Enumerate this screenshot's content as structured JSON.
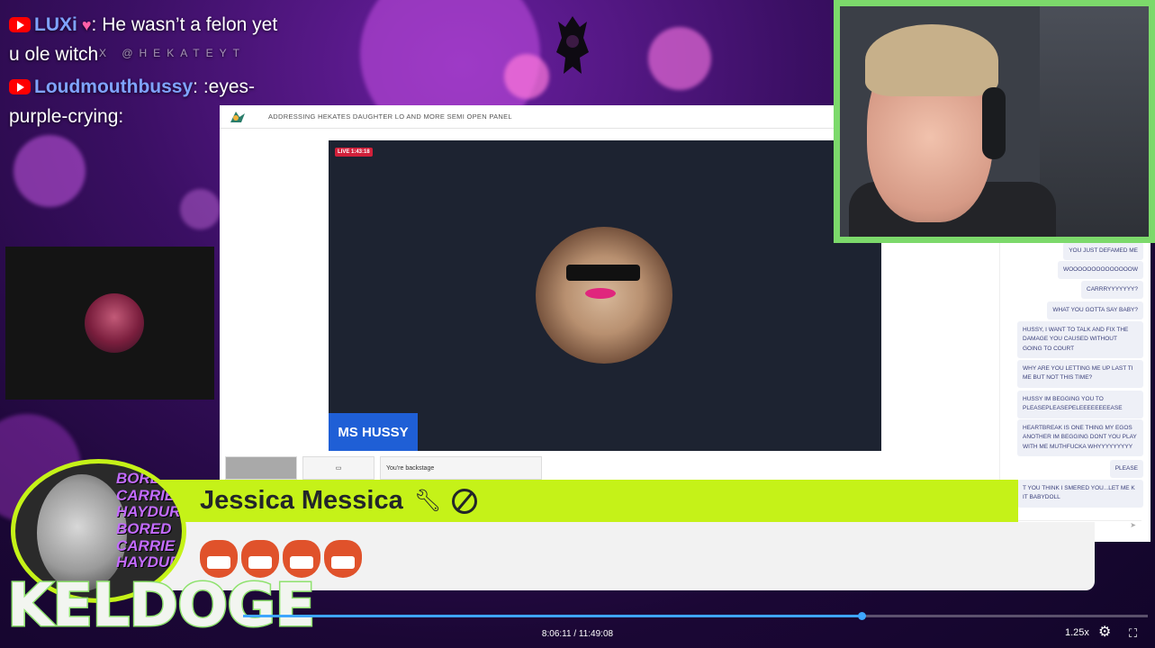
{
  "chat": {
    "messages": [
      {
        "user": "LUXi",
        "text": ": He wasn’t a felon yet u ole witch"
      },
      {
        "user": "Loudmouthbussy",
        "text": ": :eyes-purple-crying:"
      }
    ],
    "watermark": "X @HEKATEYT"
  },
  "window": {
    "title": "ADDRESSING HEKATES DAUGHTER LO AND MORE SEMI OPEN PANEL",
    "live_label": "LIVE 1:43:18",
    "guest_name": "MS HUSSY",
    "backstage_label": "You're backstage"
  },
  "side_chat": {
    "messages": [
      "YOU JUST DEFAMED ME",
      "WOOOOOOOOOOOOOOW",
      "CARRRYYYYYYY?",
      "WHAT YOU GOTTA SAY BABY?",
      "HUSSY, I WANT TO TALK AND FIX THE DAMAGE YOU CAUSED WITHOUT GOING TO COURT",
      "WHY ARE YOU LETTING ME UP LAST TI ME BUT NOT THIS TIME?",
      "HUSSY IM BEGGING YOU TO PLEASEPLEASEPELEEEEEEEEASE",
      "HEARTBREAK IS ONE THING MY EGOS ANOTHER IM BEGGING DONT YOU PLAY WITH ME MUTHFUCKA WHYYYYYYYYY",
      "PLEASE",
      "T YOU THINK I SMERED YOU...LET ME K IT BABYDOLL"
    ]
  },
  "alert": {
    "name": "Jessica Messica",
    "avatar_text": "BORED CARRIE HAYDUR BORED CARRIE HAYDUR"
  },
  "brand": "KELDOGE",
  "player": {
    "current_time": "8:06:11",
    "total_time": "11:49:08",
    "progress": 0.6833,
    "speed": "1.25x"
  },
  "colors": {
    "accent_green": "#c5f218",
    "webcam_border": "#7cd96b",
    "progress_blue": "#3ea6ff"
  }
}
